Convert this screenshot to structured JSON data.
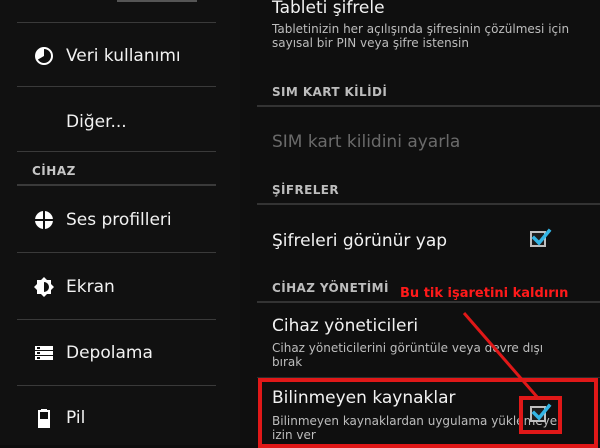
{
  "sidebar": {
    "items": [
      {
        "label": "Veri kullanımı",
        "icon": "data-usage-icon"
      },
      {
        "label": "Diğer...",
        "icon": ""
      },
      {
        "label": "Ses profilleri",
        "icon": "sound-profiles-icon"
      },
      {
        "label": "Ekran",
        "icon": "display-brightness-icon"
      },
      {
        "label": "Depolama",
        "icon": "storage-icon"
      },
      {
        "label": "Pil",
        "icon": "battery-icon"
      }
    ],
    "section_cihaz": "CİHAZ"
  },
  "main": {
    "tablet_lock": {
      "title": "Tableti şifrele",
      "summary": "Tabletinizin her açılışında şifresinin çözülmesi için sayısal bir PIN veya şifre istensin"
    },
    "section_sim": "SIM KART KİLİDİ",
    "sim_lock": {
      "title": "SIM kart kilidini ayarla"
    },
    "section_passwords": "ŞİFRELER",
    "show_passwords": {
      "title": "Şifreleri görünür yap",
      "checked": true
    },
    "section_device_admin": "CİHAZ YÖNETİMİ",
    "device_admins": {
      "title": "Cihaz yöneticileri",
      "summary": "Cihaz yöneticilerini görüntüle veya devre dışı bırak"
    },
    "unknown_sources": {
      "title": "Bilinmeyen kaynaklar",
      "summary": "Bilinmeyen kaynaklardan uygulama yüklemeye izin ver",
      "checked": true
    }
  },
  "annotation": {
    "text": "Bu tik işaretini kaldırın",
    "color": "#ff1a1a"
  },
  "colors": {
    "accent": "#33b5e5",
    "annotation": "#e01818"
  }
}
